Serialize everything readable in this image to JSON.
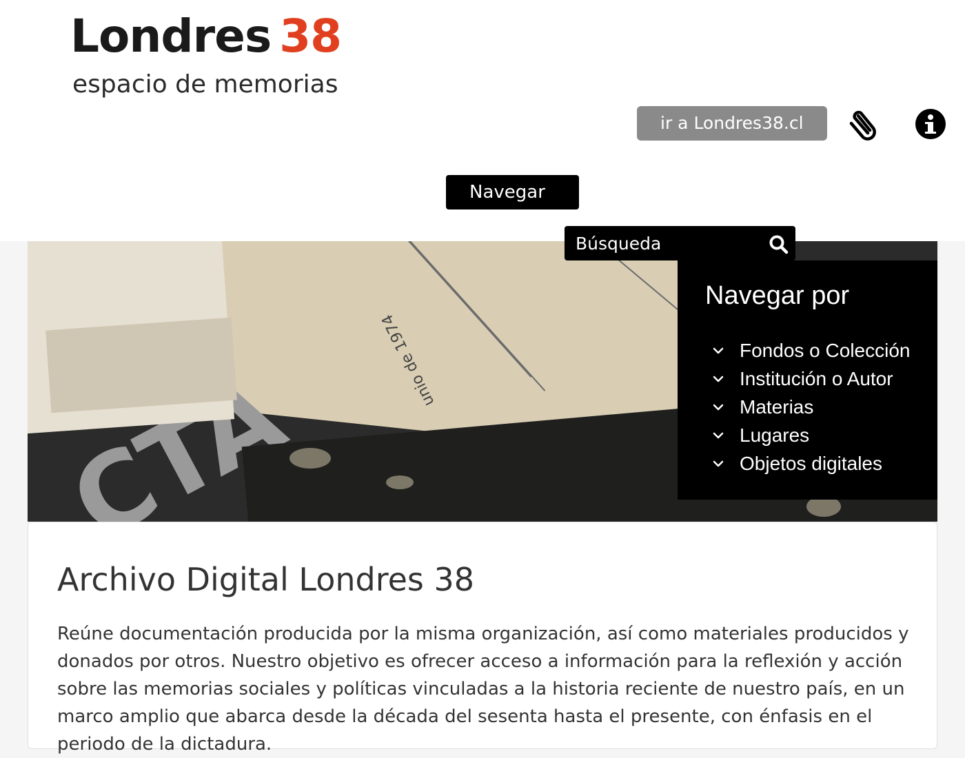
{
  "header": {
    "logo_main": "Londres",
    "logo_number": "38",
    "logo_tagline": "espacio de memorias",
    "site_button_label": "ir a Londres38.cl",
    "navigate_button_label": "Navegar"
  },
  "hero": {
    "paper_text": "unio de 1974",
    "letters_text": "CTA"
  },
  "search": {
    "placeholder": "Búsqueda"
  },
  "browse": {
    "title": "Navegar por",
    "items": [
      {
        "label": "Fondos o Colección"
      },
      {
        "label": "Institución o Autor"
      },
      {
        "label": "Materias"
      },
      {
        "label": "Lugares"
      },
      {
        "label": "Objetos digitales"
      }
    ]
  },
  "content": {
    "title": "Archivo Digital Londres 38",
    "description": "Reúne documentación producida por la misma organización, así como materiales producidos y donados por otros. Nuestro objetivo es ofrecer acceso a información para la reflexión y acción sobre las memorias sociales y políticas vinculadas a la historia reciente de nuestro país, en un marco amplio que abarca desde la década del sesenta hasta el presente, con énfasis en el periodo de la dictadura."
  },
  "colors": {
    "accent_number": "#e0401f",
    "site_button_bg": "#8a8a8a",
    "dark_panel_bg": "#000000"
  },
  "icons": {
    "attachment": "paperclip-icon",
    "info": "info-icon",
    "search": "search-icon",
    "chevron": "chevron-down-icon"
  }
}
